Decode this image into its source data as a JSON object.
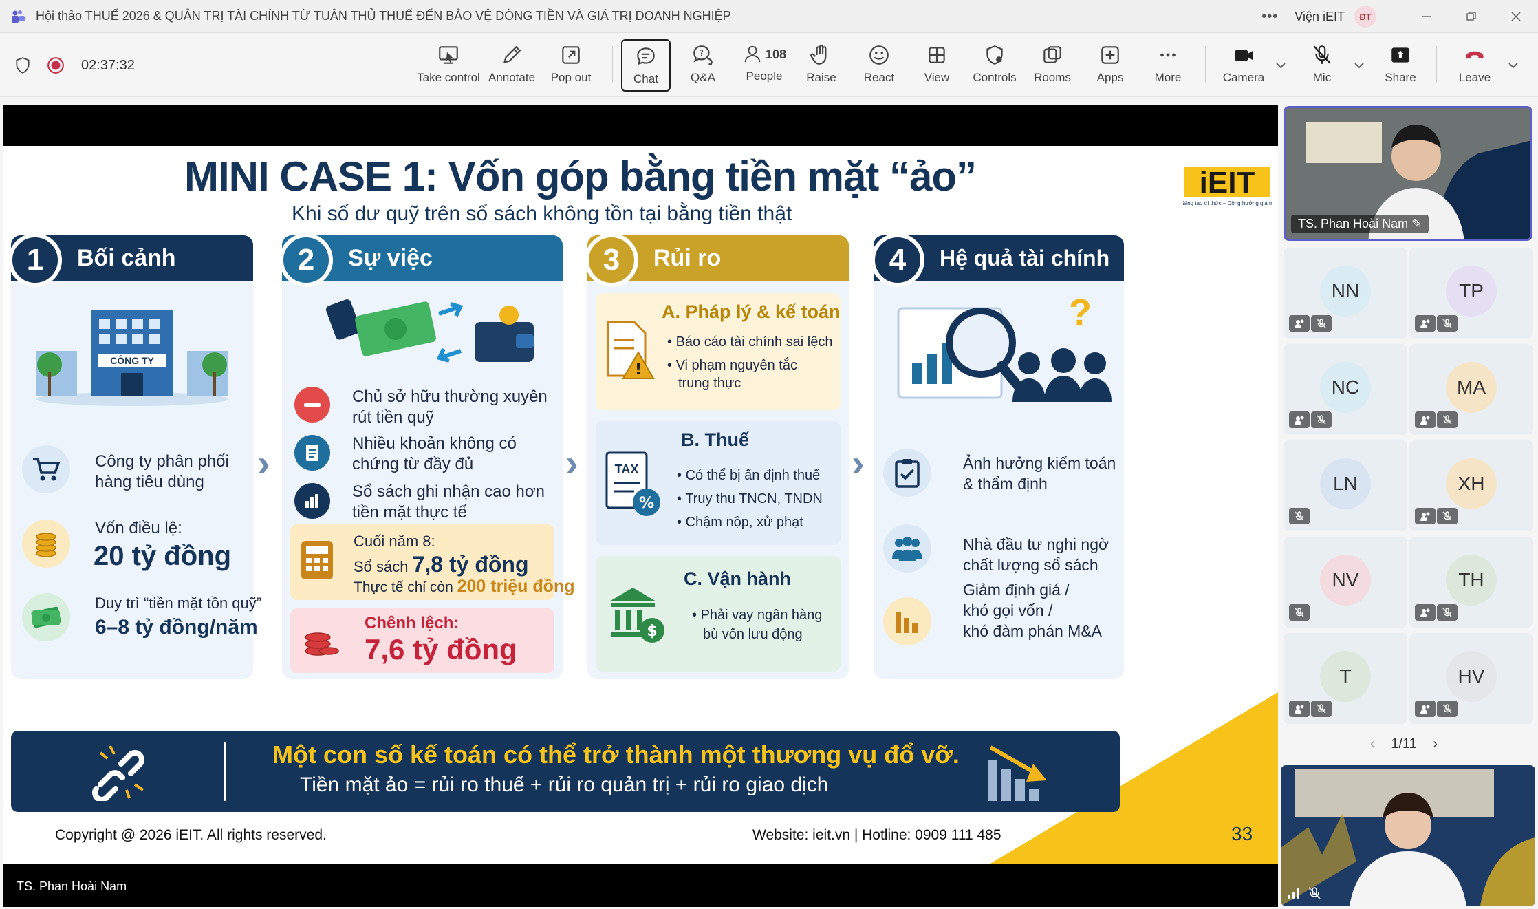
{
  "window": {
    "title": "Hội thảo THUẾ 2026 & QUẢN TRỊ TÀI CHÍNH TỪ TUÂN THỦ THUẾ ĐẾN BẢO VỆ DÒNG TIỀN VÀ GIÁ TRỊ DOANH NGHIỆP",
    "org": "Viện iEIT",
    "user_initials": "ĐT"
  },
  "toolbar": {
    "timer": "02:37:32",
    "take_control": "Take control",
    "annotate": "Annotate",
    "pop_out": "Pop out",
    "chat": "Chat",
    "qa": "Q&A",
    "people": "People",
    "people_count": "108",
    "raise": "Raise",
    "react": "React",
    "view": "View",
    "controls": "Controls",
    "rooms": "Rooms",
    "apps": "Apps",
    "more": "More",
    "camera": "Camera",
    "mic": "Mic",
    "share": "Share",
    "leave": "Leave"
  },
  "slide": {
    "title": "MINI CASE 1: Vốn góp bằng tiền mặt “ảo”",
    "subtitle": "Khi số dư quỹ trên sổ sách không tồn tại bằng tiền thật",
    "logo_text": "iEIT",
    "logo_tagline": "Sáng tạo tri thức – Cộng hưởng giá trị",
    "col1": {
      "num": "1",
      "heading": "Bối cảnh",
      "company_label": "CÔNG TY",
      "item1": [
        "Công ty phân phối",
        "hàng tiêu dùng"
      ],
      "item2_label": "Vốn điều lệ:",
      "item2_value": "20 tỷ đồng",
      "item3_label": "Duy trì “tiền mặt tồn quỹ”",
      "item3_value": "6–8 tỷ đồng/năm"
    },
    "col2": {
      "num": "2",
      "heading": "Sự việc",
      "item1": [
        "Chủ sở hữu thường xuyên",
        "rút tiền quỹ"
      ],
      "item2": [
        "Nhiều khoản không có",
        "chứng từ đầy đủ"
      ],
      "item3": [
        "Sổ sách ghi nhận cao hơn",
        "tiền mặt thực tế"
      ],
      "box1_l1": "Cuối năm 8:",
      "box1_l2a": "Sổ sách ",
      "box1_l2b": "7,8 tỷ đồng",
      "box1_l3a": "Thực tế chỉ còn ",
      "box1_l3b": "200 triệu đồng",
      "box2_l1": "Chênh lệch:",
      "box2_l2": "7,6 tỷ đồng"
    },
    "col3": {
      "num": "3",
      "heading": "Rủi ro",
      "a_title": "A. Pháp lý & kế toán",
      "a_items": [
        "Báo cáo tài chính sai lệch",
        "Vi phạm nguyên tắc",
        "trung thực"
      ],
      "b_title": "B. Thuế",
      "b_tax": "TAX",
      "b_items": [
        "Có thể bị ấn định thuế",
        "Truy thu TNCN, TNDN",
        "Chậm nộp, xử phạt"
      ],
      "c_title": "C. Vận hành",
      "c_items": [
        "Phải vay ngân hàng",
        "bù vốn lưu động"
      ]
    },
    "col4": {
      "num": "4",
      "heading": "Hệ quả tài chính",
      "item1": [
        "Ảnh hưởng kiểm toán",
        "& thẩm định"
      ],
      "item2": [
        "Nhà đầu tư nghi ngờ",
        "chất lượng sổ sách"
      ],
      "item3": [
        "Giảm định giá /",
        "khó gọi vốn /",
        "khó đàm phán M&A"
      ]
    },
    "banner_l1": "Một con số kế toán có thể trở thành một thương vụ đổ vỡ.",
    "banner_l2": "Tiền mặt ảo = rủi ro thuế + rủi ro quản trị + rủi ro giao dịch",
    "copyright": "Copyright @ 2026 iEIT. All rights reserved.",
    "website": "Website: ieit.vn | Hotline: 0909 111 485",
    "page_number": "33",
    "colors": {
      "navy": "#14345a",
      "teal": "#1f6f9e",
      "gold": "#c9a227",
      "yellow": "#f7c31a"
    }
  },
  "presenter_label": "TS. Phan Hoài Nam",
  "side": {
    "main_video_name": "TS. Phan Hoài Nam",
    "participants": [
      {
        "initials": "NN",
        "color": "#d9ebf3"
      },
      {
        "initials": "TP",
        "color": "#e6def3"
      },
      {
        "initials": "NC",
        "color": "#d9ebf3"
      },
      {
        "initials": "MA",
        "color": "#f6e4c6"
      },
      {
        "initials": "LN",
        "color": "#d9e4f3"
      },
      {
        "initials": "XH",
        "color": "#f6e4c6"
      },
      {
        "initials": "NV",
        "color": "#f3dbe0"
      },
      {
        "initials": "TH",
        "color": "#dde8dc"
      },
      {
        "initials": "T",
        "color": "#dde8dc"
      },
      {
        "initials": "HV",
        "color": "#e4e6ea"
      }
    ],
    "page": "1/11"
  }
}
